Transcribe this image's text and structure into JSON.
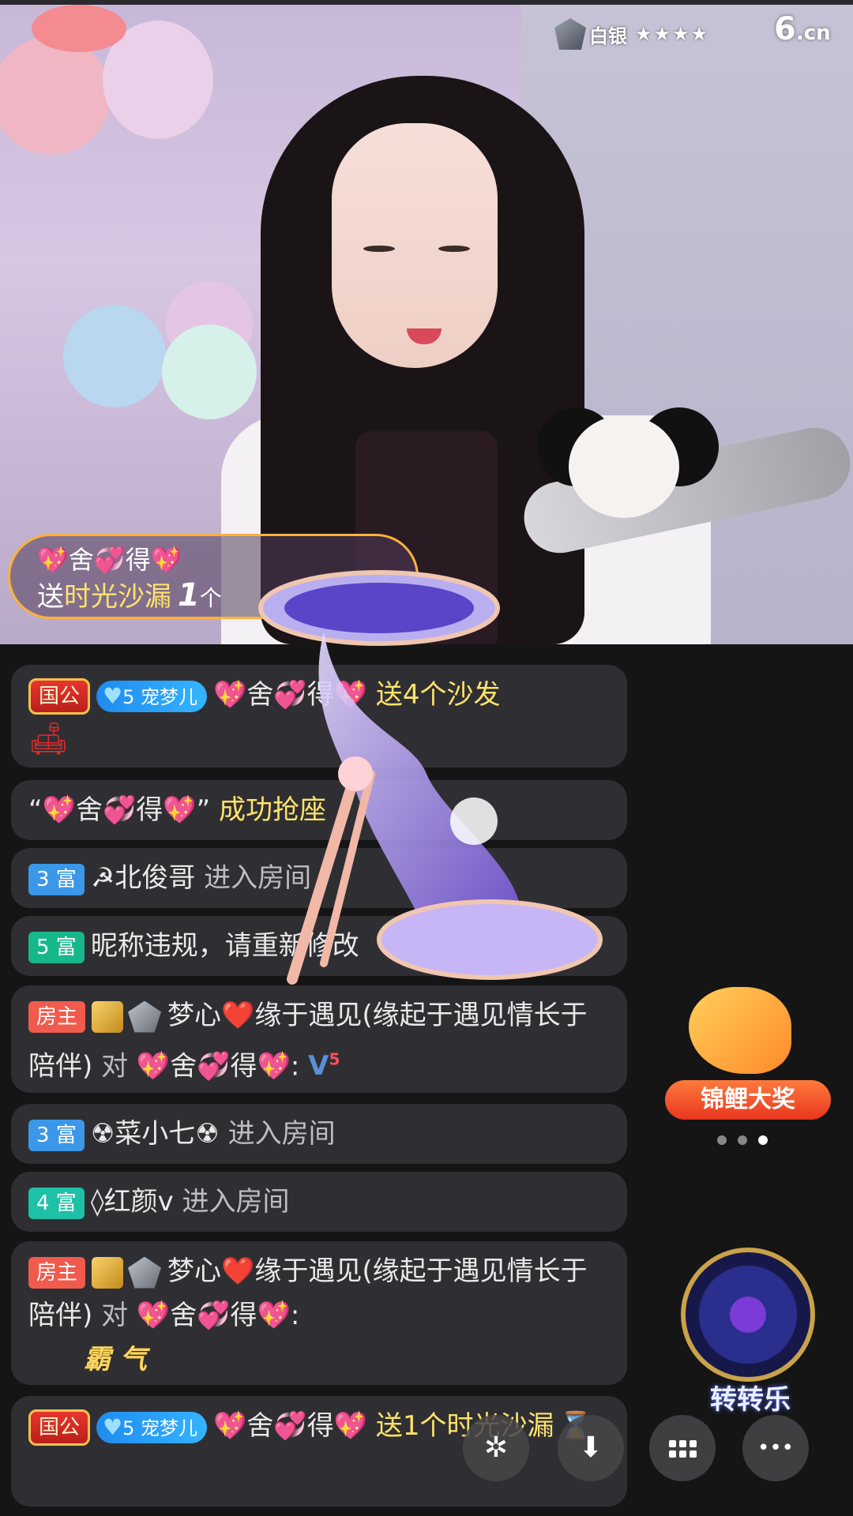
{
  "header": {
    "rank_label": "白银",
    "stars": "★★★★",
    "logo_main": "6",
    "logo_sub": ".cn"
  },
  "gift_banner": {
    "sender": "💖舍💞得💖",
    "action": "送",
    "gift_name": "时光沙漏",
    "count": "1",
    "unit": "个"
  },
  "chat": [
    {
      "tag": "国公",
      "fan_level": "5",
      "fan_name": "宠梦儿",
      "user": "💖舍💞得💖",
      "text": "送4个沙发",
      "icon": "sofa-icon"
    },
    {
      "text_a": "“💖舍💞得💖”",
      "text_b": "成功抢座"
    },
    {
      "tag": "3 富",
      "user": "☭北俊哥",
      "text": "进入房间"
    },
    {
      "tag": "5 富",
      "text": "昵称违规，请重新修改"
    },
    {
      "tag": "房主",
      "user": "梦心❤️缘于遇见(缘起于遇见情长于陪伴)",
      "to": "对",
      "target": "💖舍💞得💖:",
      "badge_level": "5"
    },
    {
      "tag": "3 富",
      "user": "☢菜小七☢",
      "text": "进入房间"
    },
    {
      "tag": "4 富",
      "user": "◊红颜v",
      "text": "进入房间"
    },
    {
      "tag": "房主",
      "user": "梦心❤️缘于遇见(缘起于遇见情长于陪伴)",
      "to": "对",
      "target": "💖舍💞得💖:",
      "sub": "霸 气"
    },
    {
      "tag": "国公",
      "fan_level": "5",
      "fan_name": "宠梦儿",
      "user": "💖舍💞得💖",
      "text": "送1个时光沙漏",
      "icon": "hourglass-icon"
    }
  ],
  "promos": {
    "koi_label": "锦鲤大奖",
    "wheel_label": "转转乐"
  },
  "buttons": {
    "share_icon": "✲",
    "download_icon": "⬇",
    "more_icon": "•••"
  },
  "colors": {
    "accent_gold": "#ffb13b",
    "gift_yellow": "#ffe36b",
    "host_red": "#f15b4e",
    "fu_blue": "#3b98e8",
    "fu_green": "#1ec0a6"
  }
}
